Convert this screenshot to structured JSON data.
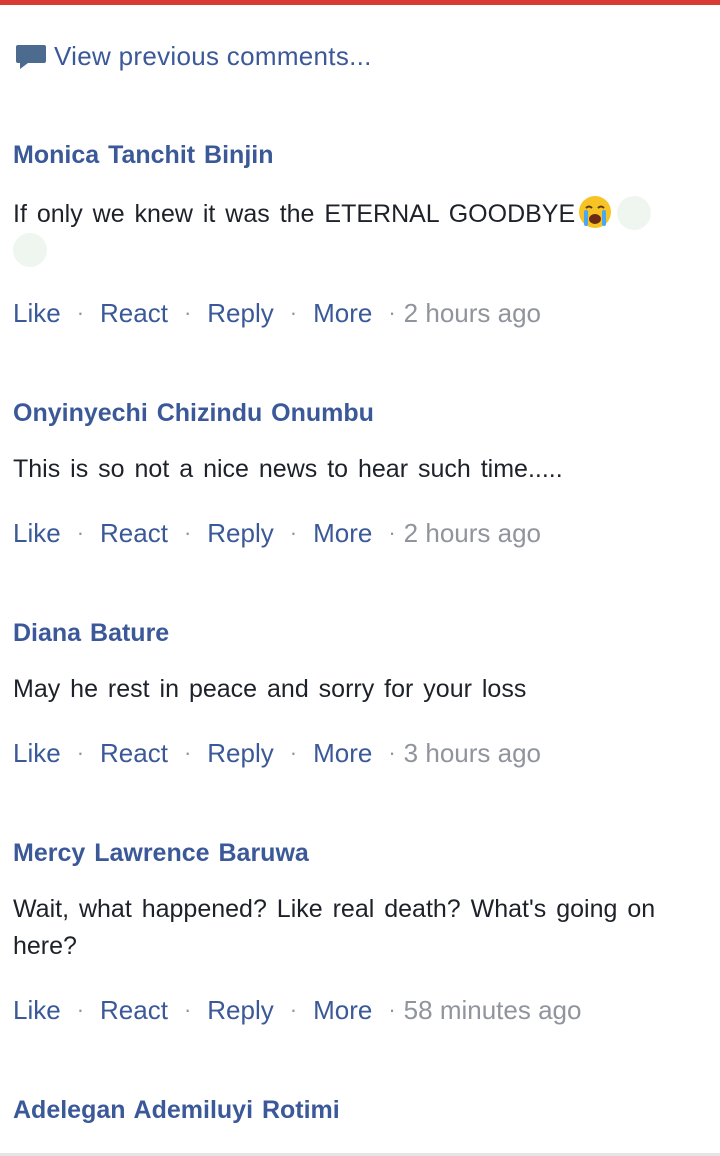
{
  "header": {
    "view_previous_label": "View previous comments...",
    "accent_color": "#d93a34",
    "link_color": "#3b5998"
  },
  "actions": {
    "like": "Like",
    "react": "React",
    "reply": "Reply",
    "more": "More",
    "separator": "·"
  },
  "comments": [
    {
      "author": "Monica Tanchit Binjin",
      "text": "If only we knew it was the ETERNAL GOODBYE",
      "emojis": [
        "loudly-crying-face",
        "blank-emoji",
        "blank-emoji"
      ],
      "time": "2 hours ago"
    },
    {
      "author": "Onyinyechi Chizindu Onumbu",
      "text": "This is so not a nice news to hear such time.....",
      "time": "2 hours ago"
    },
    {
      "author": "Diana Bature",
      "text": "May he rest in peace and sorry for your loss",
      "time": "3 hours ago"
    },
    {
      "author": "Mercy Lawrence Baruwa",
      "text": "Wait, what happened? Like real death? What's going on here?",
      "time": "58 minutes ago"
    },
    {
      "author": "Adelegan Ademiluyi Rotimi"
    }
  ]
}
